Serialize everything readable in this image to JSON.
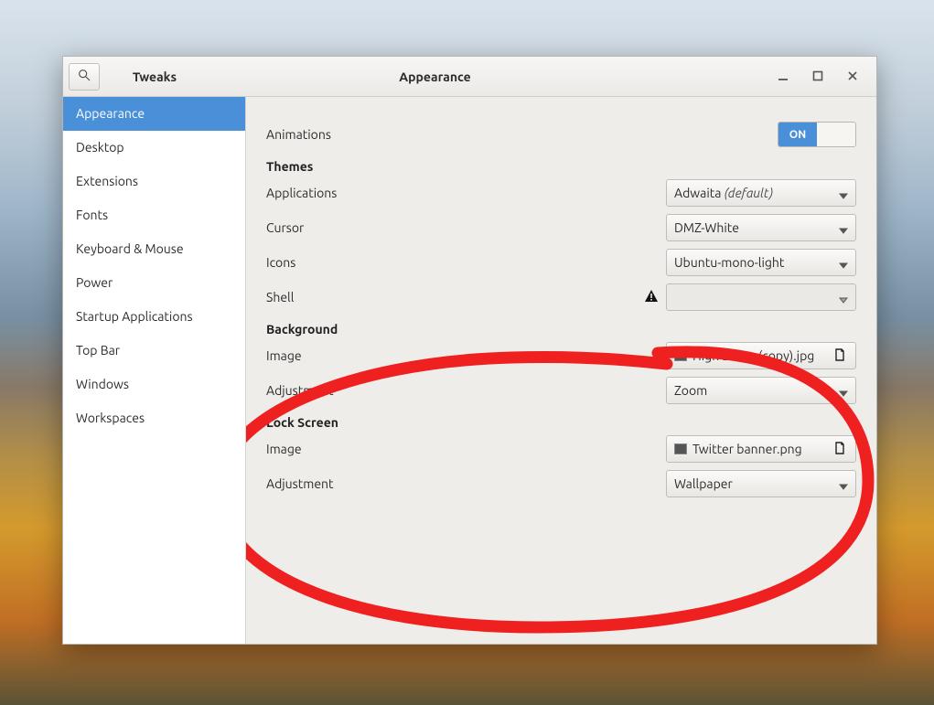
{
  "window": {
    "app_title": "Tweaks",
    "header_title": "Appearance"
  },
  "sidebar": {
    "items": [
      {
        "label": "Appearance"
      },
      {
        "label": "Desktop"
      },
      {
        "label": "Extensions"
      },
      {
        "label": "Fonts"
      },
      {
        "label": "Keyboard & Mouse"
      },
      {
        "label": "Power"
      },
      {
        "label": "Startup Applications"
      },
      {
        "label": "Top Bar"
      },
      {
        "label": "Windows"
      },
      {
        "label": "Workspaces"
      }
    ],
    "active_index": 0
  },
  "content": {
    "animations_label": "Animations",
    "animations_toggle_on": "ON",
    "themes": {
      "title": "Themes",
      "applications_label": "Applications",
      "applications_value": "Adwaita",
      "applications_suffix": "(default)",
      "cursor_label": "Cursor",
      "cursor_value": "DMZ-White",
      "icons_label": "Icons",
      "icons_value": "Ubuntu-mono-light",
      "shell_label": "Shell",
      "shell_value": ""
    },
    "background": {
      "title": "Background",
      "image_label": "Image",
      "image_value": "High Sierra (copy).jpg",
      "adjustment_label": "Adjustment",
      "adjustment_value": "Zoom"
    },
    "lockscreen": {
      "title": "Lock Screen",
      "image_label": "Image",
      "image_value": "Twitter banner.png",
      "adjustment_label": "Adjustment",
      "adjustment_value": "Wallpaper"
    }
  }
}
